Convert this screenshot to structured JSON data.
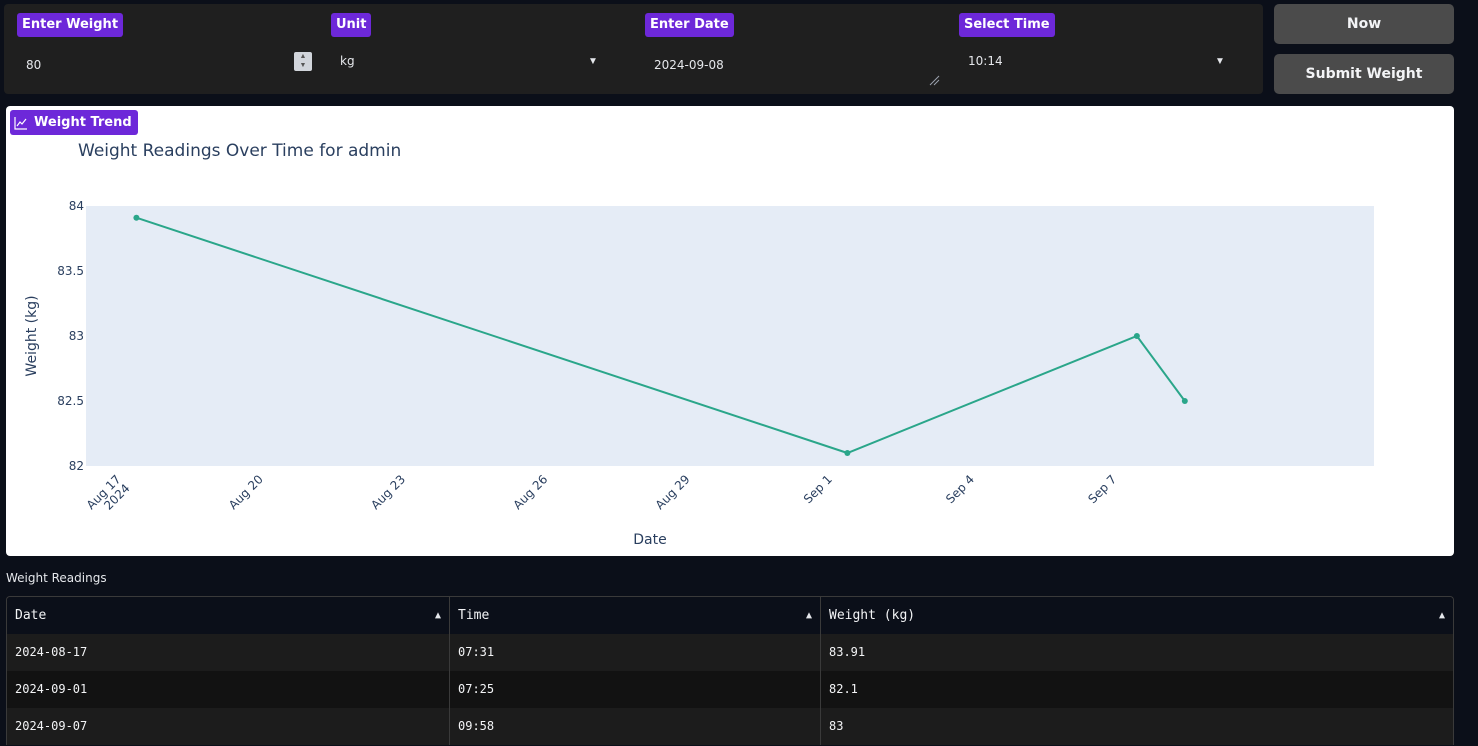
{
  "inputs": {
    "weight": {
      "label": "Enter Weight",
      "value": "80"
    },
    "unit": {
      "label": "Unit",
      "value": "kg"
    },
    "date": {
      "label": "Enter Date",
      "value": "2024-09-08"
    },
    "time": {
      "label": "Select Time",
      "value": "10:14"
    }
  },
  "buttons": {
    "now": "Now",
    "submit": "Submit Weight"
  },
  "chart_panel": {
    "tag": "Weight Trend"
  },
  "colors": {
    "accent": "#6d28d9",
    "line": "#2aa68a",
    "plot_bg": "#e5ecf6"
  },
  "chart_data": {
    "type": "line",
    "title": "Weight Readings Over Time for admin",
    "xlabel": "Date",
    "ylabel": "Weight (kg)",
    "x": [
      "2024-08-17 07:31",
      "2024-09-01 07:25",
      "2024-09-07 09:58",
      "2024-09-08 10:14"
    ],
    "y": [
      83.91,
      82.1,
      83,
      82.5
    ],
    "ylim": [
      82,
      84
    ],
    "xlim": [
      "2024-08-16 06:00",
      "2024-09-12 10:00"
    ],
    "yticks": [
      "82",
      "82.5",
      "83",
      "83.5",
      "84"
    ],
    "xticks": [
      {
        "date": "2024-08-17",
        "label": "Aug 17",
        "sub": "2024"
      },
      {
        "date": "2024-08-20",
        "label": "Aug 20"
      },
      {
        "date": "2024-08-23",
        "label": "Aug 23"
      },
      {
        "date": "2024-08-26",
        "label": "Aug 26"
      },
      {
        "date": "2024-08-29",
        "label": "Aug 29"
      },
      {
        "date": "2024-09-01",
        "label": "Sep 1"
      },
      {
        "date": "2024-09-04",
        "label": "Sep 4"
      },
      {
        "date": "2024-09-07",
        "label": "Sep 7"
      }
    ],
    "grid": false,
    "legend": "none"
  },
  "table": {
    "label": "Weight Readings",
    "columns": [
      "Date",
      "Time",
      "Weight (kg)"
    ],
    "rows": [
      [
        "2024-08-17",
        "07:31",
        "83.91"
      ],
      [
        "2024-09-01",
        "07:25",
        "82.1"
      ],
      [
        "2024-09-07",
        "09:58",
        "83"
      ]
    ]
  }
}
